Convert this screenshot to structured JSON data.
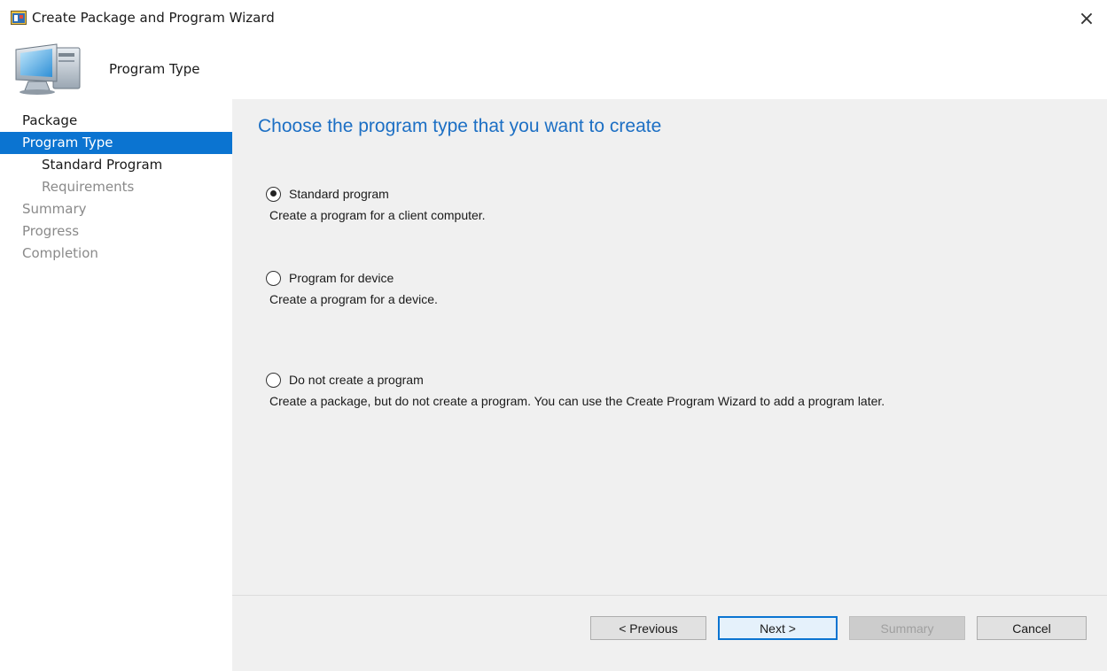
{
  "window": {
    "title": "Create Package and Program Wizard",
    "close_glyph": "×",
    "title_icon": "wizard-app-icon"
  },
  "header": {
    "title": "Program Type",
    "icon": "computer-icon"
  },
  "sidebar": {
    "items": [
      {
        "label": "Package",
        "state": "done"
      },
      {
        "label": "Program Type",
        "state": "active"
      },
      {
        "label": "Standard Program",
        "state": "current-sub"
      },
      {
        "label": "Requirements",
        "state": "pending-sub"
      },
      {
        "label": "Summary",
        "state": "pending"
      },
      {
        "label": "Progress",
        "state": "pending"
      },
      {
        "label": "Completion",
        "state": "pending"
      }
    ]
  },
  "main": {
    "heading": "Choose the program type that you want to create",
    "options": [
      {
        "label": "Standard program",
        "description": "Create a program for a client computer.",
        "checked": true
      },
      {
        "label": "Program for device",
        "description": "Create a program for a device.",
        "checked": false
      },
      {
        "label": "Do not create a program",
        "description": "Create a package, but do not create a program. You can use the Create Program Wizard to add a program later.",
        "checked": false
      }
    ]
  },
  "footer": {
    "previous_label": "< Previous",
    "next_label": "Next >",
    "summary_label": "Summary",
    "cancel_label": "Cancel"
  },
  "colors": {
    "accent": "#0b74d1",
    "heading": "#1c6fc4",
    "panel": "#f0f0f0"
  }
}
